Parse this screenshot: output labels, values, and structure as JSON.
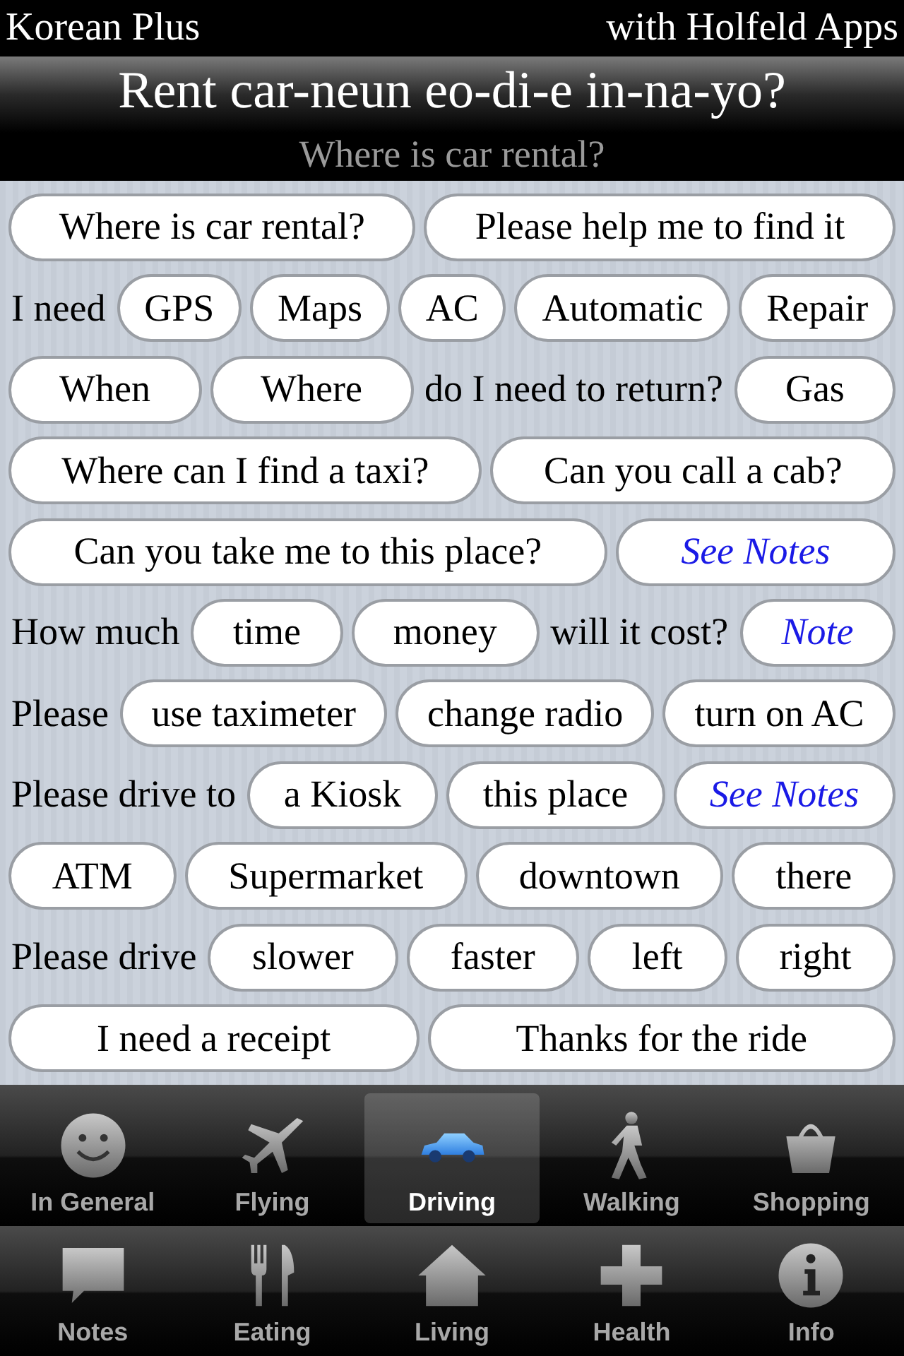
{
  "top_bar": {
    "app_name": "Korean Plus",
    "credit": "with Holfeld Apps"
  },
  "header": {
    "title": "Rent car-neun eo-di-e in-na-yo?",
    "subtitle": "Where is car rental?"
  },
  "phrase_rows": [
    {
      "items": [
        {
          "kind": "button",
          "text": "Where is car rental?"
        },
        {
          "kind": "button",
          "text": "Please help me to find it"
        }
      ]
    },
    {
      "items": [
        {
          "kind": "label",
          "text": "I need"
        },
        {
          "kind": "button",
          "text": "GPS"
        },
        {
          "kind": "button",
          "text": "Maps"
        },
        {
          "kind": "button",
          "text": "AC"
        },
        {
          "kind": "button",
          "text": "Automatic"
        },
        {
          "kind": "button",
          "text": "Repair"
        }
      ]
    },
    {
      "items": [
        {
          "kind": "button",
          "text": "When"
        },
        {
          "kind": "button",
          "text": "Where"
        },
        {
          "kind": "label",
          "text": "do I need to return?"
        },
        {
          "kind": "button",
          "text": "Gas"
        }
      ]
    },
    {
      "items": [
        {
          "kind": "button",
          "text": "Where can I find a taxi?"
        },
        {
          "kind": "button",
          "text": "Can you call a cab?"
        }
      ]
    },
    {
      "items": [
        {
          "kind": "button",
          "text": "Can you take me to this place?"
        },
        {
          "kind": "note",
          "text": "See Notes"
        }
      ]
    },
    {
      "items": [
        {
          "kind": "label",
          "text": "How much"
        },
        {
          "kind": "button",
          "text": "time"
        },
        {
          "kind": "button",
          "text": "money"
        },
        {
          "kind": "label",
          "text": "will it cost?"
        },
        {
          "kind": "note",
          "text": "Note"
        }
      ]
    },
    {
      "items": [
        {
          "kind": "label",
          "text": "Please"
        },
        {
          "kind": "button",
          "text": "use taximeter"
        },
        {
          "kind": "button",
          "text": "change radio"
        },
        {
          "kind": "button",
          "text": "turn on AC"
        }
      ]
    },
    {
      "items": [
        {
          "kind": "label",
          "text": "Please drive to"
        },
        {
          "kind": "button",
          "text": "a Kiosk"
        },
        {
          "kind": "button",
          "text": "this place"
        },
        {
          "kind": "note",
          "text": "See Notes"
        }
      ]
    },
    {
      "items": [
        {
          "kind": "button",
          "text": "ATM"
        },
        {
          "kind": "button",
          "text": "Supermarket"
        },
        {
          "kind": "button",
          "text": "downtown"
        },
        {
          "kind": "button",
          "text": "there"
        }
      ]
    },
    {
      "items": [
        {
          "kind": "label",
          "text": "Please drive"
        },
        {
          "kind": "button",
          "text": "slower"
        },
        {
          "kind": "button",
          "text": "faster"
        },
        {
          "kind": "button",
          "text": "left"
        },
        {
          "kind": "button",
          "text": "right"
        }
      ]
    },
    {
      "items": [
        {
          "kind": "button",
          "text": "I need a receipt"
        },
        {
          "kind": "button",
          "text": "Thanks for the ride"
        }
      ]
    }
  ],
  "tab_bar": {
    "rows": [
      {
        "tabs": [
          {
            "label": "In General",
            "selected": false
          },
          {
            "label": "Flying",
            "selected": false
          },
          {
            "label": "Driving",
            "selected": true
          },
          {
            "label": "Walking",
            "selected": false
          },
          {
            "label": "Shopping",
            "selected": false
          }
        ]
      },
      {
        "tabs": [
          {
            "label": "Notes",
            "selected": false
          },
          {
            "label": "Eating",
            "selected": false
          },
          {
            "label": "Living",
            "selected": false
          },
          {
            "label": "Health",
            "selected": false
          },
          {
            "label": "Info",
            "selected": false
          }
        ]
      }
    ]
  }
}
